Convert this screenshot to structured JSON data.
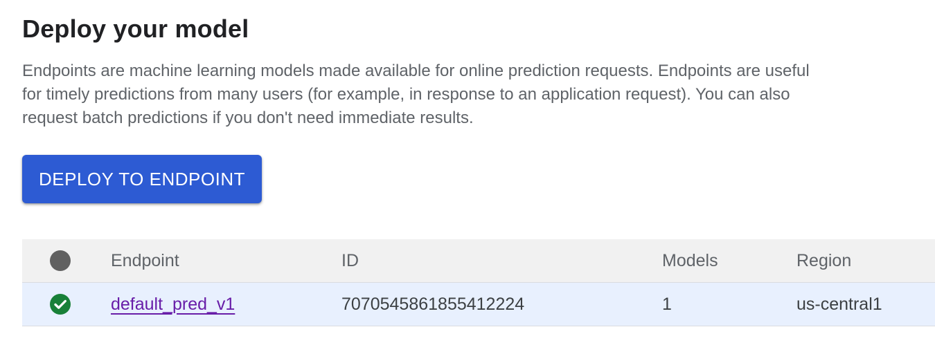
{
  "page": {
    "title": "Deploy your model",
    "description": "Endpoints are machine learning models made available for online prediction requests. Endpoints are useful for timely predictions from many users (for example, in response to an application request). You can also request batch predictions if you don't need immediate results."
  },
  "actions": {
    "deploy_label": "DEPLOY TO ENDPOINT"
  },
  "table": {
    "columns": {
      "status_icon": "status-circle-icon",
      "endpoint": "Endpoint",
      "id": "ID",
      "models": "Models",
      "region": "Region"
    },
    "rows": [
      {
        "status": "success",
        "status_icon": "check-circle-icon",
        "endpoint": "default_pred_v1",
        "id": "7070545861855412224",
        "models": "1",
        "region": "us-central1"
      }
    ]
  },
  "colors": {
    "primary_button": "#2d5bd3",
    "success": "#188038",
    "link": "#681da8",
    "header_bg": "#f1f1f1",
    "selected_row_bg": "#e8f0fe"
  }
}
